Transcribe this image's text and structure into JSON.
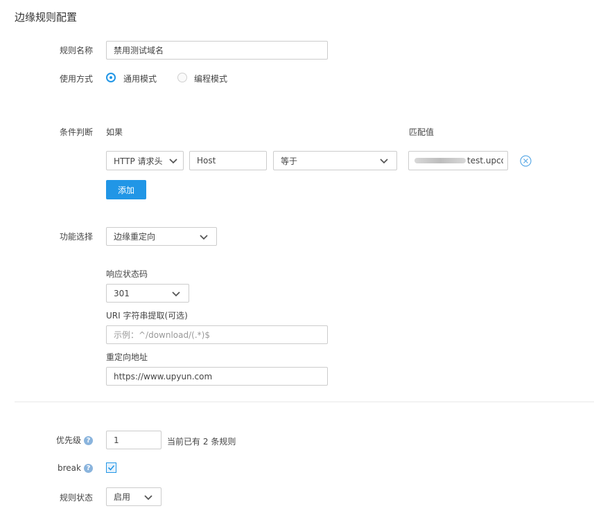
{
  "page": {
    "title": "边缘规则配置"
  },
  "rule_name": {
    "label": "规则名称",
    "value": "禁用测试域名"
  },
  "usage": {
    "label": "使用方式",
    "options": [
      {
        "label": "通用模式",
        "selected": true
      },
      {
        "label": "编程模式",
        "selected": false
      }
    ]
  },
  "condition": {
    "label": "条件判断",
    "if_header": "如果",
    "match_header": "匹配值",
    "type_value": "HTTP 请求头",
    "field_value": "Host",
    "operator_value": "等于",
    "match_value": "test.upcdn.",
    "add_label": "添加"
  },
  "feature": {
    "label": "功能选择",
    "value": "边缘重定向",
    "status_code_label": "响应状态码",
    "status_code_value": "301",
    "uri_label": "URI 字符串提取(可选)",
    "uri_placeholder": "示例：^/download/(.*)$",
    "redirect_label": "重定向地址",
    "redirect_value": "https://www.upyun.com"
  },
  "priority": {
    "label": "优先级",
    "value": "1",
    "note_prefix": "当前已有",
    "count": "2",
    "note_suffix": "条规则"
  },
  "break_opt": {
    "label": "break",
    "checked": true
  },
  "rule_status": {
    "label": "规则状态",
    "value": "启用"
  },
  "colors": {
    "accent": "#2196e6",
    "border": "#cccccc",
    "text": "#333333"
  },
  "icons": {
    "help": "help-circle-icon",
    "remove": "remove-circle-icon",
    "dropdown": "chevron-down-icon",
    "check": "check-icon"
  }
}
